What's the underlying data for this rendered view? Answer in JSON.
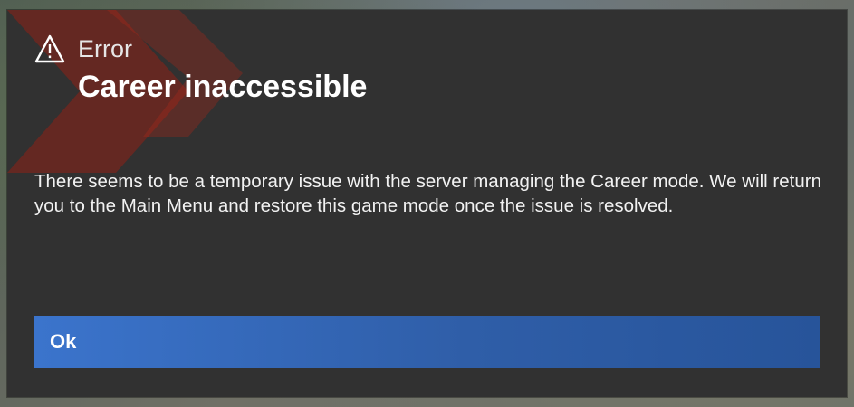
{
  "dialog": {
    "error_label": "Error",
    "title": "Career inaccessible",
    "message": "There seems to be a temporary issue with the server managing the Career mode. We will return you to the Main Menu and restore this game mode once the issue is resolved.",
    "ok_label": "Ok"
  },
  "icons": {
    "header_icon": "warning-triangle-icon"
  },
  "colors": {
    "dialog_background": "#313131",
    "button_blue": "#2f5ea8",
    "accent_red": "#b5281c",
    "text_white": "#ffffff"
  }
}
